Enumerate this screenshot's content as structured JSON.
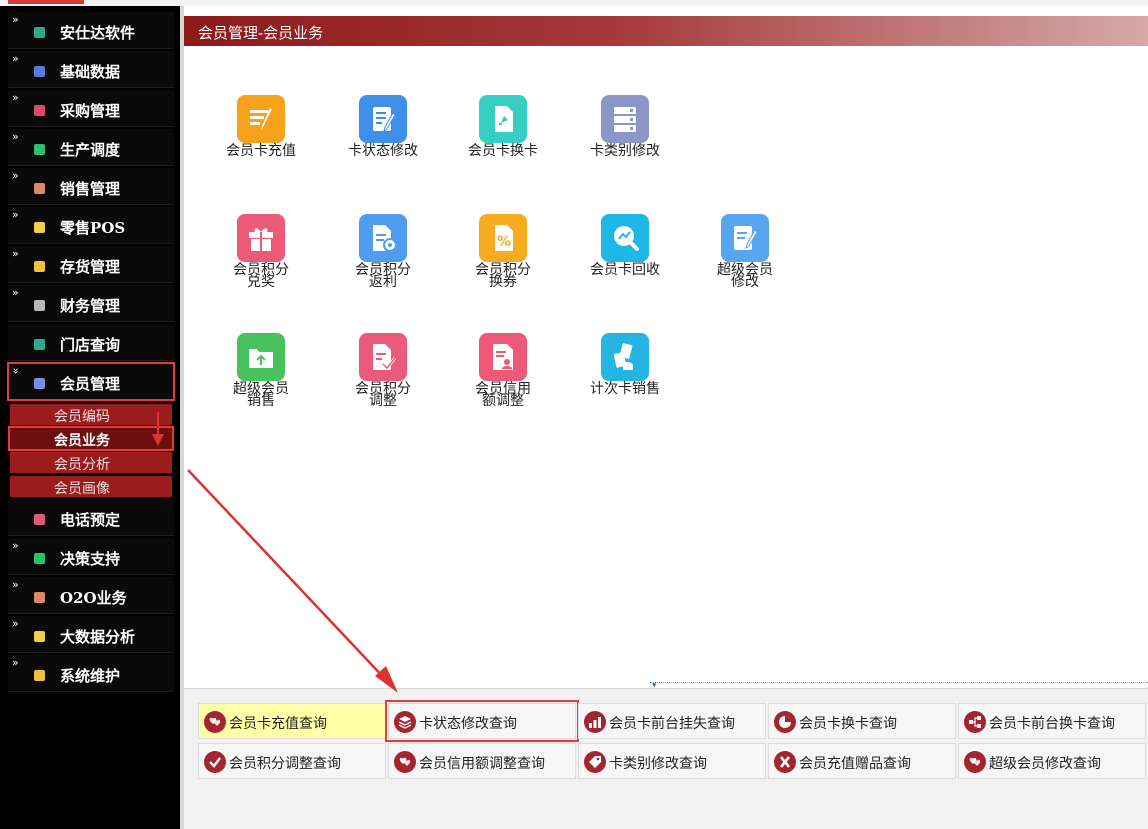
{
  "header": {
    "title": "会员管理-会员业务"
  },
  "sidebar": {
    "items": [
      {
        "label": "安仕达软件",
        "icon": "module-icon",
        "color": "#2fa98c"
      },
      {
        "label": "基础数据",
        "icon": "module-icon",
        "color": "#5a7be0"
      },
      {
        "label": "采购管理",
        "icon": "module-icon",
        "color": "#e04a6a"
      },
      {
        "label": "生产调度",
        "icon": "module-icon",
        "color": "#2cc06a"
      },
      {
        "label": "销售管理",
        "icon": "module-icon",
        "color": "#d88a6a"
      },
      {
        "label": "零售POS",
        "icon": "module-icon",
        "color": "#f0d24a"
      },
      {
        "label": "存货管理",
        "icon": "module-icon",
        "color": "#f0c040"
      },
      {
        "label": "财务管理",
        "icon": "module-icon",
        "color": "#b8b8b8"
      },
      {
        "label": "门店查询",
        "icon": "module-icon",
        "color": "#2fa98c"
      },
      {
        "label": "会员管理",
        "icon": "module-icon",
        "color": "#7a8ce8",
        "active": true
      },
      {
        "label": "电话预定",
        "icon": "module-icon",
        "color": "#e05a7a"
      },
      {
        "label": "决策支持",
        "icon": "module-icon",
        "color": "#2cc06a"
      },
      {
        "label": "O2O业务",
        "icon": "module-icon",
        "color": "#d88a6a"
      },
      {
        "label": "大数据分析",
        "icon": "module-icon",
        "color": "#f0d24a"
      },
      {
        "label": "系统维护",
        "icon": "module-icon",
        "color": "#f0c040"
      }
    ],
    "submenu": [
      {
        "label": "会员编码"
      },
      {
        "label": "会员业务",
        "selected": true
      },
      {
        "label": "会员分析"
      },
      {
        "label": "会员画像"
      }
    ]
  },
  "tiles": [
    {
      "label": "会员卡充值",
      "icon": "card-recharge-icon",
      "color": "#f7a21b"
    },
    {
      "label": "卡状态修改",
      "icon": "card-status-edit-icon",
      "color": "#3f8fe8"
    },
    {
      "label": "会员卡换卡",
      "icon": "card-replace-icon",
      "color": "#35cfc3"
    },
    {
      "label": "卡类别修改",
      "icon": "card-type-edit-icon",
      "color": "#8c95c7"
    },
    {
      "label": "会员积分兑奖",
      "icon": "points-gift-icon",
      "color": "#ec5a78"
    },
    {
      "label": "会员积分返利",
      "icon": "points-rebate-icon",
      "color": "#4f9cf0"
    },
    {
      "label": "会员积分换券",
      "icon": "points-coupon-icon",
      "color": "#f7ab1e"
    },
    {
      "label": "会员卡回收",
      "icon": "card-recycle-icon",
      "color": "#1fb8e6"
    },
    {
      "label": "超级会员修改",
      "icon": "super-member-edit-icon",
      "color": "#58a6f0"
    },
    {
      "label": "超级会员销售",
      "icon": "super-member-sale-icon",
      "color": "#47c25d"
    },
    {
      "label": "会员积分调整",
      "icon": "points-adjust-icon",
      "color": "#ea5a7a"
    },
    {
      "label": "会员信用额调整",
      "icon": "credit-adjust-icon",
      "color": "#ec5a78"
    },
    {
      "label": "计次卡销售",
      "icon": "count-card-sale-icon",
      "color": "#24b5e3"
    }
  ],
  "queries": [
    {
      "label": "会员卡充值查询",
      "icon": "hearts-icon"
    },
    {
      "label": "卡状态修改查询",
      "icon": "layers-icon"
    },
    {
      "label": "会员卡前台挂失查询",
      "icon": "bar-chart-icon"
    },
    {
      "label": "会员卡换卡查询",
      "icon": "pie-chart-icon"
    },
    {
      "label": "会员卡前台换卡查询",
      "icon": "network-icon"
    },
    {
      "label": "会员积分调整查询",
      "icon": "check-icon"
    },
    {
      "label": "会员信用额调整查询",
      "icon": "hearts-icon"
    },
    {
      "label": "卡类别修改查询",
      "icon": "tag-icon"
    },
    {
      "label": "会员充值赠品查询",
      "icon": "x-icon"
    },
    {
      "label": "超级会员修改查询",
      "icon": "hearts-icon"
    }
  ]
}
